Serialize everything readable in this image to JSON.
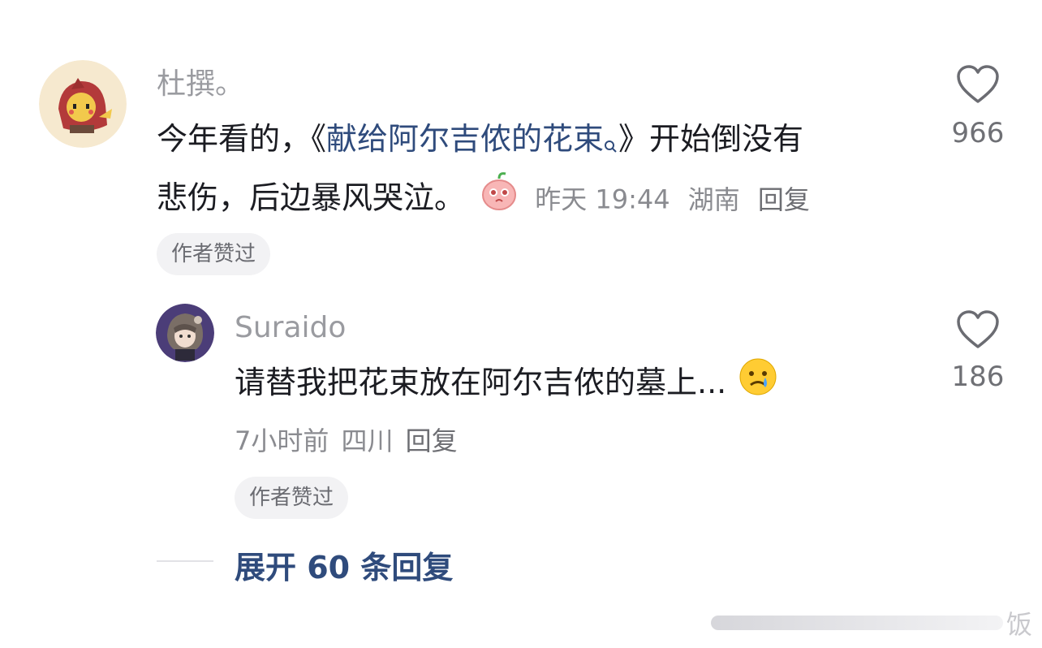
{
  "comment1": {
    "username": "杜撰。",
    "text_before": "今年看的，《",
    "link_text": "献给阿尔吉侬的花束",
    "text_after": "》开始倒没有",
    "text_line2": "悲伤，后边暴风哭泣。",
    "time": "昨天 19:44",
    "location": "湖南",
    "reply_label": "回复",
    "author_liked": "作者赞过",
    "like_count": "966"
  },
  "reply1": {
    "username": "Suraido",
    "text": "请替我把花束放在阿尔吉侬的墓上...",
    "time": "7小时前",
    "location": "四川",
    "reply_label": "回复",
    "author_liked": "作者赞过",
    "like_count": "186"
  },
  "expand": {
    "label": "展开 60 条回复"
  },
  "watermark": {
    "text": "饭"
  },
  "colors": {
    "link": "#2f4b7c",
    "meta": "#8a8b90",
    "pill_bg": "#f2f2f4"
  }
}
